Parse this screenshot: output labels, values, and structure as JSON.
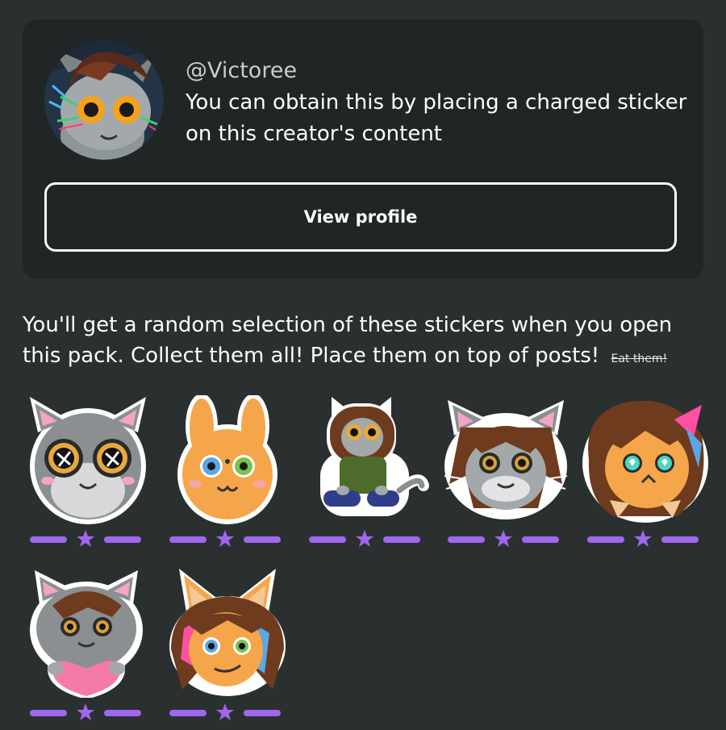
{
  "creator": {
    "handle": "@Victoree",
    "description": "You can obtain this by placing a charged sticker on this creator's content",
    "view_profile_label": "View profile"
  },
  "pack": {
    "intro": "You'll get a random selection of these stickers when you open this pack. Collect them all! Place them on top of posts!",
    "strike_text": "Eat them!"
  },
  "stickers": [
    {
      "name": "gray-cat-sparkle-eyes",
      "rarity_stars": 1
    },
    {
      "name": "orange-bunny",
      "rarity_stars": 1
    },
    {
      "name": "cat-in-green-sweater",
      "rarity_stars": 1
    },
    {
      "name": "brown-hair-gray-cat",
      "rarity_stars": 1
    },
    {
      "name": "orange-fox-heart-eyes",
      "rarity_stars": 1
    },
    {
      "name": "gray-cat-holding-heart",
      "rarity_stars": 1
    },
    {
      "name": "orange-fox-smirk",
      "rarity_stars": 1
    }
  ],
  "colors": {
    "background": "#2a302f",
    "card": "#202625",
    "rarity_accent": "#a166ee"
  }
}
